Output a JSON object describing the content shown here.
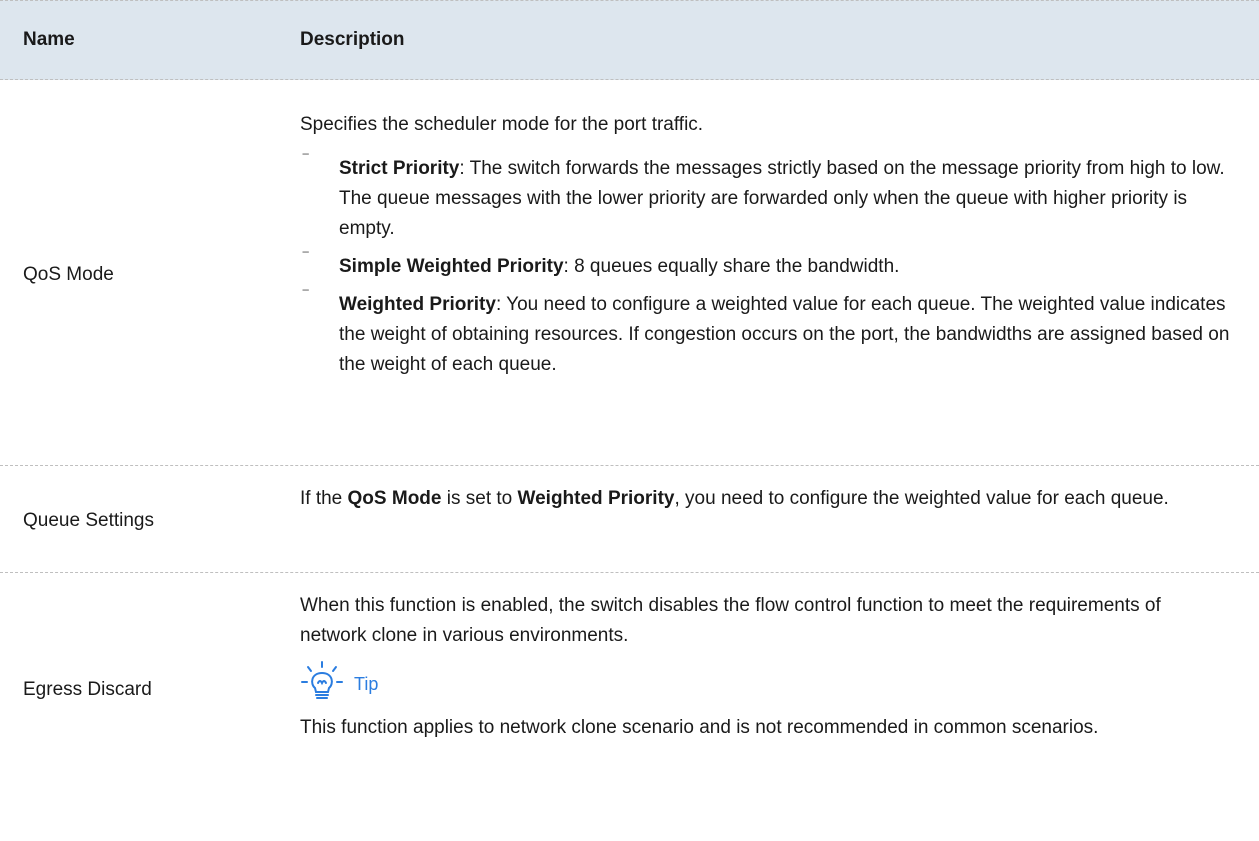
{
  "header": {
    "name": "Name",
    "description": "Description"
  },
  "rows": {
    "qos": {
      "name": "QoS Mode",
      "intro": "Specifies the scheduler mode for the port traffic.",
      "bullets": [
        {
          "term": "Strict Priority",
          "text": ": The switch forwards the messages strictly based on the message priority from high to low. The queue messages with the lower priority are forwarded only when the queue with higher priority is empty."
        },
        {
          "term": "Simple Weighted Priority",
          "text": ": 8 queues equally share the bandwidth."
        },
        {
          "term": "Weighted Priority",
          "text": ": You need to configure a weighted value for each queue. The weighted value indicates the weight of obtaining resources. If congestion occurs on the port, the bandwidths are assigned based on the weight of each queue."
        }
      ]
    },
    "queue": {
      "name": "Queue Settings",
      "p1": "If the ",
      "b1": "QoS Mode",
      "p2": " is set to ",
      "b2": "Weighted Priority",
      "p3": ", you need to configure the weighted value for each queue."
    },
    "egress": {
      "name": "Egress Discard",
      "text": "When this function is enabled, the switch disables the flow control function to meet the requirements of network clone in various environments.",
      "tip_label": "Tip",
      "tip_icon": "lightbulb-icon",
      "tip_text": "This function applies to network clone scenario and is not recommended in common scenarios."
    }
  },
  "colors": {
    "header_bg": "#dde6ee",
    "tip": "#2b7de0"
  }
}
